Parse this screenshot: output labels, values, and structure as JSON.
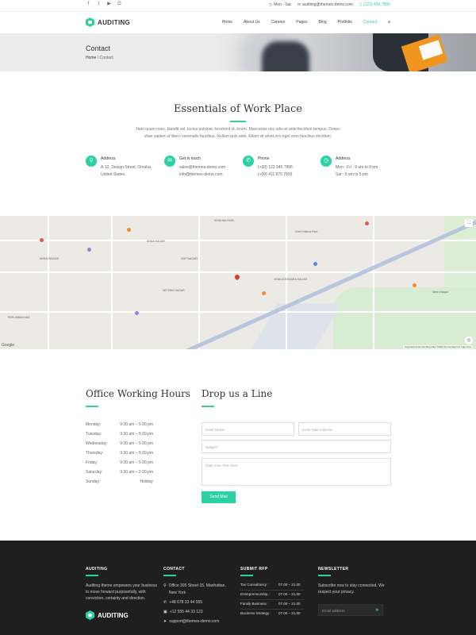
{
  "topbar": {
    "social_icons": [
      "facebook-icon",
      "twitter-icon",
      "youtube-icon",
      "google-plus-icon"
    ],
    "hours": "Mon - Sat",
    "email": "auditing@themes-demo.com",
    "phone": "(123) 456-7890"
  },
  "brand": {
    "name": "AUDITING"
  },
  "nav": {
    "items": [
      "Home",
      "About Us",
      "Careers",
      "Pages",
      "Blog",
      "Portfolio",
      "Contact"
    ],
    "active": "Contact"
  },
  "page_header": {
    "title": "Contact",
    "crumb_home": "Home",
    "crumb_sep": "/",
    "crumb_current": "Contact"
  },
  "essentials": {
    "title": "Essentials of Work Place",
    "description": "Nam quam nunc, blandit vel, luctus pulvinar, hendrerit id, lorem. Maecenas nec odio et ante tincidunt tempus. Donec vitae sapien ut libero venenatis faucibus. Nullam quis ante. Etiam sit amet orci eget eros faucibus tincidunt.",
    "items": [
      {
        "icon": "map-pin-icon",
        "label": "Address",
        "line1": "A-12, Design Street, Omaha,",
        "line2": "United States."
      },
      {
        "icon": "envelope-icon",
        "label": "Get in touch",
        "line1": "sales@themes-demo.com",
        "line2": "info@themes-demo.com"
      },
      {
        "icon": "phone-icon",
        "label": "Phone",
        "line1": "(+00) 123 345 7895",
        "line2": "(+00) 411 879 7893"
      },
      {
        "icon": "clock-icon",
        "label": "Address",
        "line1": "Mon - Fri : 9 am to 9 pm",
        "line2": "Sat : 9 am to 5 pm"
      }
    ]
  },
  "map": {
    "labels": [
      "KRISHNA PARK",
      "ANNA NAGAR",
      "NGP NAGAR",
      "NETHRA NAGAR",
      "PERUMBAKKAM",
      "ANNAI NAGAR",
      "VENKATESWARA NAGAR",
      "Nehru Nagar",
      "Sree Krishna Park"
    ],
    "attribution": "Keyboard shortcuts   Map data ©2023   Terms   Report a map error",
    "google": "Google"
  },
  "office_hours": {
    "title": "Office Working Hours",
    "rows": [
      {
        "day": "Monday:",
        "time": "9.00 am – 5.00 pm"
      },
      {
        "day": "Tuesday:",
        "time": "9.00 am – 5.00 pm"
      },
      {
        "day": "Wednesday:",
        "time": "9.00 am – 5.00 pm"
      },
      {
        "day": "Thursday:",
        "time": "9.00 am – 5.00 pm"
      },
      {
        "day": "Friday:",
        "time": "9.00 am – 5.00 pm"
      },
      {
        "day": "Saturday:",
        "time": "9.00 am – 2.00 pm"
      },
      {
        "day": "Sunday:",
        "time": "Holiday"
      }
    ]
  },
  "drop_line": {
    "title": "Drop us a Line",
    "name_placeholder": "Enter Name",
    "email_placeholder": "Enter Mail Address",
    "subject_placeholder": "Subject",
    "message_placeholder": "Type Your Text Here",
    "send_label": "Send Mail"
  },
  "footer": {
    "about_heading": "AUDITING",
    "about_text": "Auditing theme empowers your business to move forward purposefully, with conviction, certainty and direction.",
    "contact_heading": "CONTACT",
    "contact_address_l1": "Office 305 Street 15, Manhattan,",
    "contact_address_l2": "New York",
    "contact_phone1": "+48 678 33 44 555",
    "contact_phone2": "+12 555 44 33 123",
    "contact_email": "support@themes-demo.com",
    "rfp_heading": "SUBMIT RFP",
    "rfp_rows": [
      {
        "label": "Tax Consultancy :",
        "time": "07.00 – 21.00"
      },
      {
        "label": "Entrepreneurship :",
        "time": "07.00 – 21.00"
      },
      {
        "label": "Family Business :",
        "time": "07.00 – 21.00"
      },
      {
        "label": "Business Strategy :",
        "time": "07.00 – 21.00"
      }
    ],
    "news_heading": "NEWSLETTER",
    "news_text": "Subscribe now to stay connected. We respect your privacy.",
    "news_placeholder": "Email address"
  },
  "colors": {
    "accent": "#2bd1a3",
    "footer_bg": "#1f1f1f"
  }
}
